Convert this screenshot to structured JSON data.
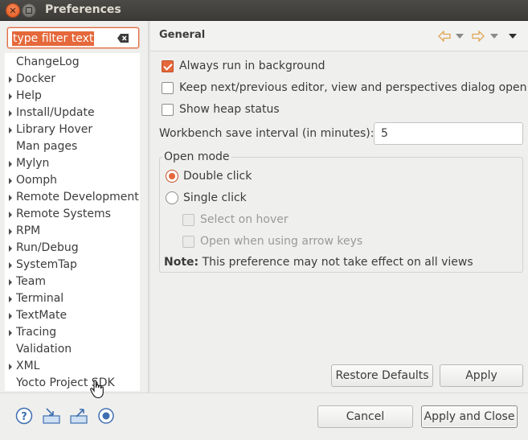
{
  "window": {
    "title": "Preferences"
  },
  "filter": {
    "text": "type filter text"
  },
  "tree": {
    "items": [
      {
        "label": "ChangeLog",
        "expandable": false
      },
      {
        "label": "Docker",
        "expandable": true
      },
      {
        "label": "Help",
        "expandable": true
      },
      {
        "label": "Install/Update",
        "expandable": true
      },
      {
        "label": "Library Hover",
        "expandable": true
      },
      {
        "label": "Man pages",
        "expandable": false
      },
      {
        "label": "Mylyn",
        "expandable": true
      },
      {
        "label": "Oomph",
        "expandable": true
      },
      {
        "label": "Remote Development",
        "expandable": true
      },
      {
        "label": "Remote Systems",
        "expandable": true
      },
      {
        "label": "RPM",
        "expandable": true
      },
      {
        "label": "Run/Debug",
        "expandable": true
      },
      {
        "label": "SystemTap",
        "expandable": true
      },
      {
        "label": "Team",
        "expandable": true
      },
      {
        "label": "Terminal",
        "expandable": true
      },
      {
        "label": "TextMate",
        "expandable": true
      },
      {
        "label": "Tracing",
        "expandable": true
      },
      {
        "label": "Validation",
        "expandable": false
      },
      {
        "label": "XML",
        "expandable": true
      },
      {
        "label": "Yocto Project SDK",
        "expandable": false
      }
    ]
  },
  "page": {
    "title": "General",
    "always_run_bg": {
      "label": "Always run in background",
      "checked": true
    },
    "keep_next_prev": {
      "label": "Keep next/previous editor, view and perspectives dialog open",
      "checked": false
    },
    "show_heap": {
      "label": "Show heap status",
      "checked": false
    },
    "save_interval": {
      "label": "Workbench save interval (in minutes):",
      "value": "5"
    },
    "open_mode": {
      "title": "Open mode",
      "double_click": {
        "label": "Double click",
        "selected": true
      },
      "single_click": {
        "label": "Single click",
        "selected": false
      },
      "select_on_hover": {
        "label": "Select on hover",
        "enabled": false
      },
      "open_arrow_keys": {
        "label": "Open when using arrow keys",
        "enabled": false
      },
      "note_label": "Note:",
      "note_text": " This preference may not take effect on all views"
    },
    "restore_defaults": "Restore Defaults",
    "apply": "Apply"
  },
  "dialog": {
    "cancel": "Cancel",
    "apply_and_close": "Apply and Close"
  },
  "colors": {
    "accent": "#e5683a",
    "titlebar": "#3c3b37",
    "nav_arrow": "#e8b66a"
  },
  "icons": [
    "help-icon",
    "import-icon",
    "export-icon",
    "record-icon",
    "back-icon",
    "forward-icon",
    "view-menu-icon",
    "clear-icon"
  ]
}
